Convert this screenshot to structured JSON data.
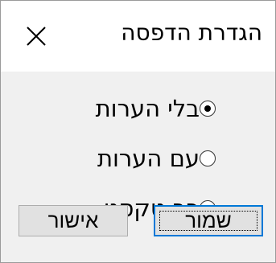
{
  "dialog": {
    "title": "הגדרת הדפסה",
    "close_icon": "close-x-icon"
  },
  "options": {
    "selected_index": 0,
    "items": [
      {
        "label": "בלי הערות",
        "checked": true
      },
      {
        "label": "עם הערות",
        "checked": false
      },
      {
        "label": "רב טקסט",
        "checked": false
      }
    ]
  },
  "buttons": {
    "save_label": "שמור",
    "ok_label": "אישור"
  },
  "colors": {
    "title_bg": "#ffffff",
    "client_bg": "#f0f0f0",
    "button_bg": "#e1e1e1",
    "default_button_border": "#0078d7"
  }
}
